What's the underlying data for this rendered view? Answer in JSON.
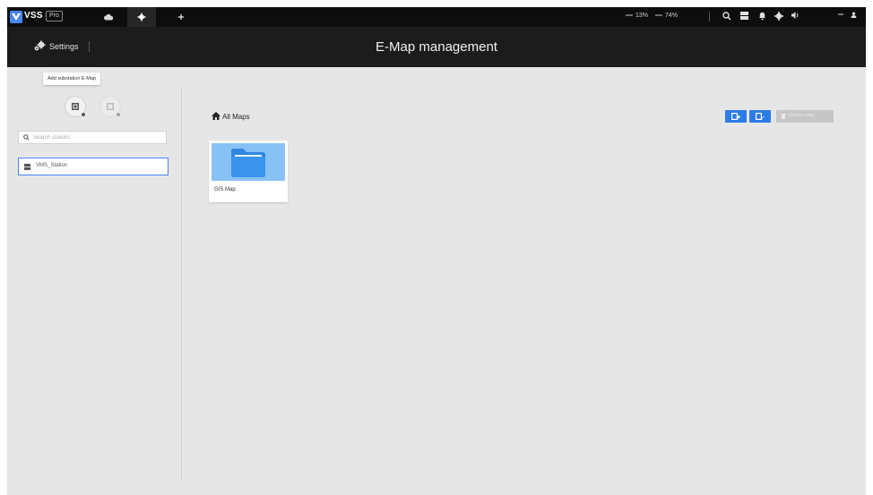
{
  "topbar": {
    "logo_text": "VSS",
    "logo_tag": "Pro",
    "cpu_text": "13%",
    "memory_text": "74%",
    "tabs": [
      {
        "icon": "cloud-icon",
        "active": false
      },
      {
        "icon": "gear-icon",
        "active": true
      },
      {
        "icon": "plus-icon",
        "active": false
      }
    ],
    "right_icons": [
      "search-icon",
      "grid-icon",
      "bell-icon",
      "settings-icon",
      "volume-icon",
      "minimize-icon",
      "user-icon"
    ]
  },
  "header": {
    "settings_label": "Settings",
    "page_title": "E-Map management"
  },
  "left_panel": {
    "tooltip": "Add substation E-Map",
    "search_placeholder": "Search stations",
    "stations": [
      {
        "label": "VMS_Station",
        "icon": "station-icon",
        "selected": true
      }
    ]
  },
  "main": {
    "breadcrumb": "All Maps",
    "actions": {
      "add_map_icon": "add-map-icon",
      "edit_map_icon": "edit-map-icon",
      "delete_label": "Delete map"
    },
    "maps": [
      {
        "label": "GIS Map",
        "icon": "folder-icon"
      }
    ]
  },
  "colors": {
    "accent": "#2d7be8",
    "topbar_bg": "#0d0d0d",
    "header_bg": "#1c1c1c",
    "content_bg": "#e6e6e6",
    "thumb_bg": "#88c2f5"
  }
}
